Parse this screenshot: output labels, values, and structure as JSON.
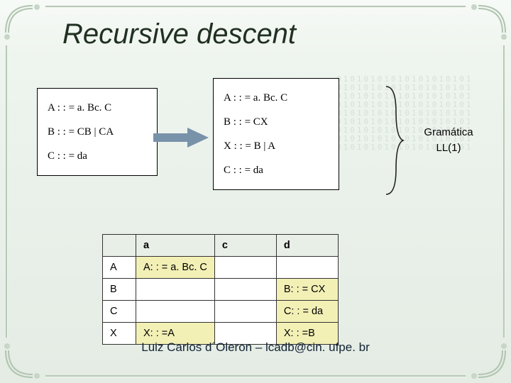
{
  "title": "Recursive descent",
  "grammar_left": {
    "r0": "A : : = a. Bc. C",
    "r1": "B : : = CB | CA",
    "r2": "C : : = da"
  },
  "grammar_right": {
    "r0": "A : : = a. Bc. C",
    "r1": "B : : = CX",
    "r2": "X : : = B | A",
    "r3": "C : : = da"
  },
  "label": {
    "line1": "Gramática",
    "line2": "LL(1)"
  },
  "table": {
    "headers": {
      "c0": "",
      "c1": "a",
      "c2": "c",
      "c3": "d"
    },
    "rows": [
      {
        "h": "A",
        "a": "A: : = a. Bc. C",
        "c": "",
        "d": ""
      },
      {
        "h": "B",
        "a": "",
        "c": "",
        "d": "B: : = CX"
      },
      {
        "h": "C",
        "a": "",
        "c": "",
        "d": "C: : = da"
      },
      {
        "h": "X",
        "a": "X: : =A",
        "c": "",
        "d": "X: : =B"
      }
    ]
  },
  "footer": "Luiz Carlos d´Oleron – lcadb@cin. ufpe. br"
}
